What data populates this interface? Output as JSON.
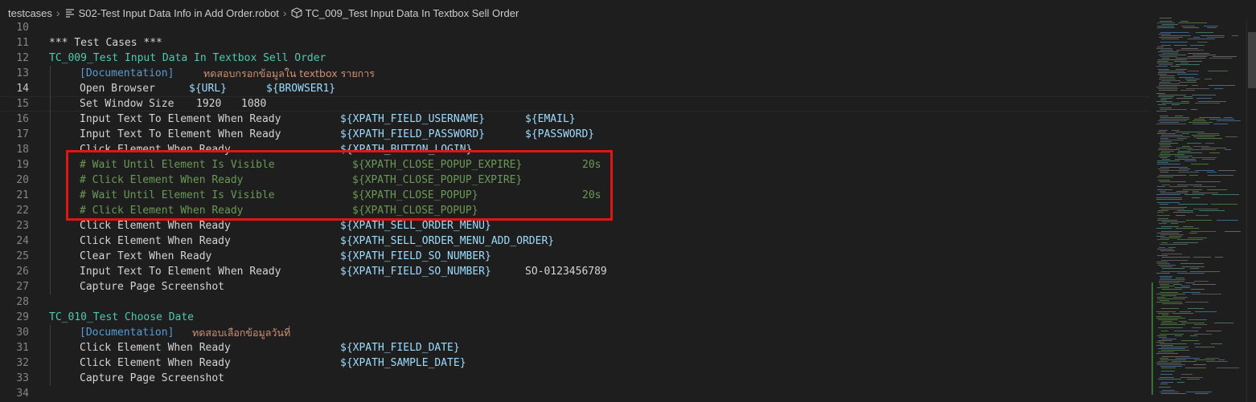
{
  "breadcrumbs": {
    "folder": "testcases",
    "file": "S02-Test Input Data Info in Add Order.robot",
    "symbol": "TC_009_Test Input Data In Textbox Sell Order",
    "file_icon": "file-lines-icon",
    "symbol_icon": "cube-icon"
  },
  "editor": {
    "active_line": "14",
    "lines": [
      {
        "num": "10"
      },
      {
        "num": "11",
        "head": "*** Test Cases ***"
      },
      {
        "num": "12",
        "tc": "TC_009_Test Input Data In Textbox Sell Order"
      },
      {
        "num": "13",
        "doc": "[Documentation]",
        "thai": "ทดสอบกรอกข้อมูลใน textbox รายการ"
      },
      {
        "num": "14",
        "kw": "Open Browser",
        "a1": "${URL}",
        "a2": "${BROWSER1}"
      },
      {
        "num": "15",
        "kw": "Set Window Size",
        "a1": "1920",
        "a2": "1080"
      },
      {
        "num": "16",
        "kw": "Input Text To Element When Ready",
        "a1": "${XPATH_FIELD_USERNAME}",
        "a2": "${EMAIL}"
      },
      {
        "num": "17",
        "kw": "Input Text To Element When Ready",
        "a1": "${XPATH_FIELD_PASSWORD}",
        "a2": "${PASSWORD}"
      },
      {
        "num": "18",
        "kw": "Click Element When Ready",
        "a1": "${XPATH_BUTTON_LOGIN}"
      },
      {
        "num": "19",
        "comment": "# Wait Until Element Is Visible",
        "c1": "${XPATH_CLOSE_POPUP_EXPIRE}",
        "c2": "20s"
      },
      {
        "num": "20",
        "comment": "# Click Element When Ready",
        "c1": "${XPATH_CLOSE_POPUP_EXPIRE}"
      },
      {
        "num": "21",
        "comment": "# Wait Until Element Is Visible",
        "c1": "${XPATH_CLOSE_POPUP}",
        "c2": "20s"
      },
      {
        "num": "22",
        "comment": "# Click Element When Ready",
        "c1": "${XPATH_CLOSE_POPUP}"
      },
      {
        "num": "23",
        "kw": "Click Element When Ready",
        "a1": "${XPATH_SELL_ORDER_MENU}"
      },
      {
        "num": "24",
        "kw": "Click Element When Ready",
        "a1": "${XPATH_SELL_ORDER_MENU_ADD_ORDER}"
      },
      {
        "num": "25",
        "kw": "Clear Text When Ready",
        "a1": "${XPATH_FIELD_SO_NUMBER}"
      },
      {
        "num": "26",
        "kw": "Input Text To Element When Ready",
        "a1": "${XPATH_FIELD_SO_NUMBER}",
        "a2": "SO-0123456789"
      },
      {
        "num": "27",
        "kw": "Capture Page Screenshot"
      },
      {
        "num": "28"
      },
      {
        "num": "29",
        "tc": "TC_010_Test Choose Date"
      },
      {
        "num": "30",
        "doc": "[Documentation]",
        "thai": "ทดสอบเลือกข้อมูลวันที่"
      },
      {
        "num": "31",
        "kw": "Click Element When Ready",
        "a1": "${XPATH_FIELD_DATE}"
      },
      {
        "num": "32",
        "kw": "Click Element When Ready",
        "a1": "${XPATH_SAMPLE_DATE}"
      },
      {
        "num": "33",
        "kw": "Capture Page Screenshot"
      },
      {
        "num": "34"
      }
    ]
  },
  "colors": {
    "background": "#1e1e1e",
    "testcase": "#4ec9b0",
    "variable": "#9cdcfe",
    "comment": "#6a9955",
    "thai_string": "#ce9178",
    "highlight_border": "#e01616"
  }
}
